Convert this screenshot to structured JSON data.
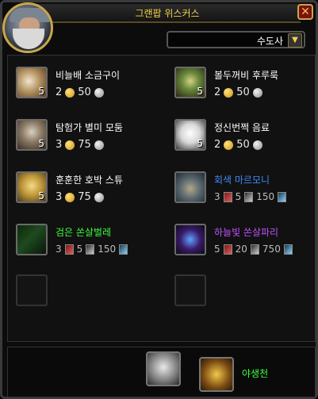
{
  "window": {
    "title": "그랜팝 위스커스"
  },
  "filter": {
    "selected": "수도사"
  },
  "items": [
    {
      "name": "비늘배 소금구이",
      "count": "5",
      "price": {
        "gold": "2",
        "silver": "50"
      },
      "name_color": "#ffffff",
      "icon": "fish-icon"
    },
    {
      "name": "볼두꺼비 후루룩",
      "count": "5",
      "price": {
        "gold": "2",
        "silver": "50"
      },
      "name_color": "#ffffff",
      "icon": "soup-bowl-icon"
    },
    {
      "name": "탐험가 별미 모둠",
      "count": "5",
      "price": {
        "gold": "3",
        "silver": "75"
      },
      "name_color": "#ffffff",
      "icon": "bag-icon"
    },
    {
      "name": "정신번쩍 음료",
      "count": "5",
      "price": {
        "gold": "2",
        "silver": "50"
      },
      "name_color": "#ffffff",
      "icon": "cup-icon"
    },
    {
      "name": "훈훈한 호박 스튜",
      "count": "5",
      "price": {
        "gold": "3",
        "silver": "75"
      },
      "name_color": "#ffffff",
      "icon": "stew-icon"
    },
    {
      "name": "회색 마르모니",
      "count": "",
      "price": {
        "a": "3",
        "b": "5",
        "c": "150"
      },
      "name_color": "#3e8df7",
      "icon": "marmoni-icon"
    },
    {
      "name": "검은 쏜살벌레",
      "count": "",
      "price": {
        "a": "3",
        "b": "5",
        "c": "150"
      },
      "name_color": "#3cff3c",
      "icon": "black-dragonfly-icon"
    },
    {
      "name": "하늘빛 쏜살파리",
      "count": "",
      "price": {
        "a": "5",
        "b": "20",
        "c": "750"
      },
      "name_color": "#c050ff",
      "icon": "sky-dragonfly-icon"
    }
  ],
  "bottom": {
    "wild_label": "야생천",
    "bag_icon": "money-bag-icon",
    "wild_icon": "wild-spiral-icon"
  }
}
